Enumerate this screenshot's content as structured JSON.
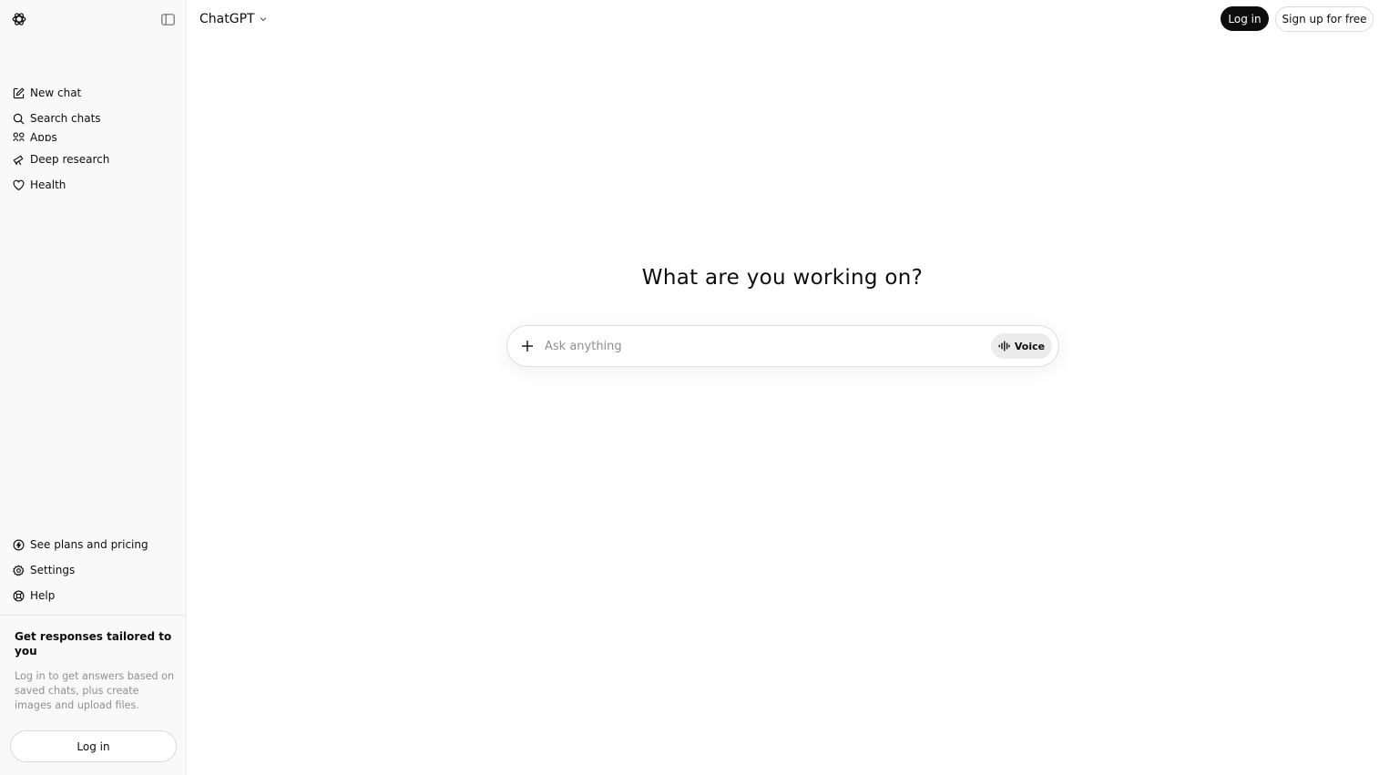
{
  "sidebar": {
    "logo_icon": "openai-logo-icon",
    "collapse_icon": "sidebar-toggle-icon",
    "items": [
      {
        "label": "New chat",
        "icon": "edit-icon"
      },
      {
        "label": "Search chats",
        "icon": "search-icon"
      },
      {
        "label": "Apps",
        "icon": "apps-icon"
      },
      {
        "label": "Deep research",
        "icon": "telescope-icon"
      },
      {
        "label": "Health",
        "icon": "heart-icon"
      }
    ],
    "bottom_items": [
      {
        "label": "See plans and pricing",
        "icon": "plans-icon"
      },
      {
        "label": "Settings",
        "icon": "gear-icon"
      },
      {
        "label": "Help",
        "icon": "help-icon"
      }
    ],
    "promo": {
      "title": "Get responses tailored to you",
      "text": "Log in to get answers based on saved chats, plus create images and upload files.",
      "button": "Log in"
    }
  },
  "header": {
    "model_name": "ChatGPT",
    "login": "Log in",
    "signup": "Sign up for free"
  },
  "main": {
    "headline": "What are you working on?",
    "composer": {
      "placeholder": "Ask anything",
      "value": "",
      "voice_label": "Voice"
    }
  },
  "colors": {
    "sidebar_bg": "#f9f9f9",
    "primary_button": "#0d0d0d",
    "placeholder": "#8f8f8f",
    "voice_bg": "#ececec"
  }
}
